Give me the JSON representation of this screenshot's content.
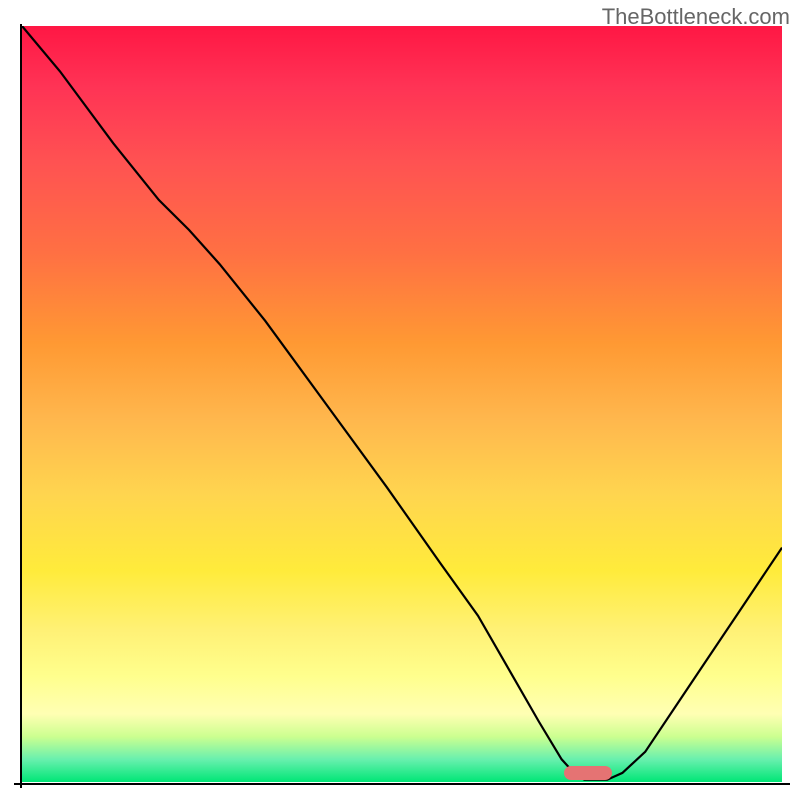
{
  "watermark": "TheBottleneck.com",
  "chart_data": {
    "type": "line",
    "title": "",
    "xlabel": "",
    "ylabel": "",
    "xlim": [
      0,
      100
    ],
    "ylim": [
      0,
      100
    ],
    "curve_points_pct": [
      [
        0,
        100
      ],
      [
        5,
        94
      ],
      [
        12,
        84.5
      ],
      [
        18,
        77
      ],
      [
        22,
        73
      ],
      [
        26,
        68.5
      ],
      [
        32,
        61
      ],
      [
        40,
        50
      ],
      [
        48,
        39
      ],
      [
        55,
        29
      ],
      [
        60,
        22
      ],
      [
        64,
        15
      ],
      [
        68,
        8
      ],
      [
        71,
        3
      ],
      [
        73,
        0.8
      ],
      [
        74,
        0.3
      ],
      [
        77,
        0.3
      ],
      [
        79,
        1.2
      ],
      [
        82,
        4
      ],
      [
        86,
        10
      ],
      [
        90,
        16
      ],
      [
        94,
        22
      ],
      [
        98,
        28
      ],
      [
        100,
        31
      ]
    ],
    "marker": {
      "x_pct": 74.5,
      "y_pct": 0.8
    },
    "gradient_meaning": "bottleneck severity (red=high, green=low)"
  }
}
